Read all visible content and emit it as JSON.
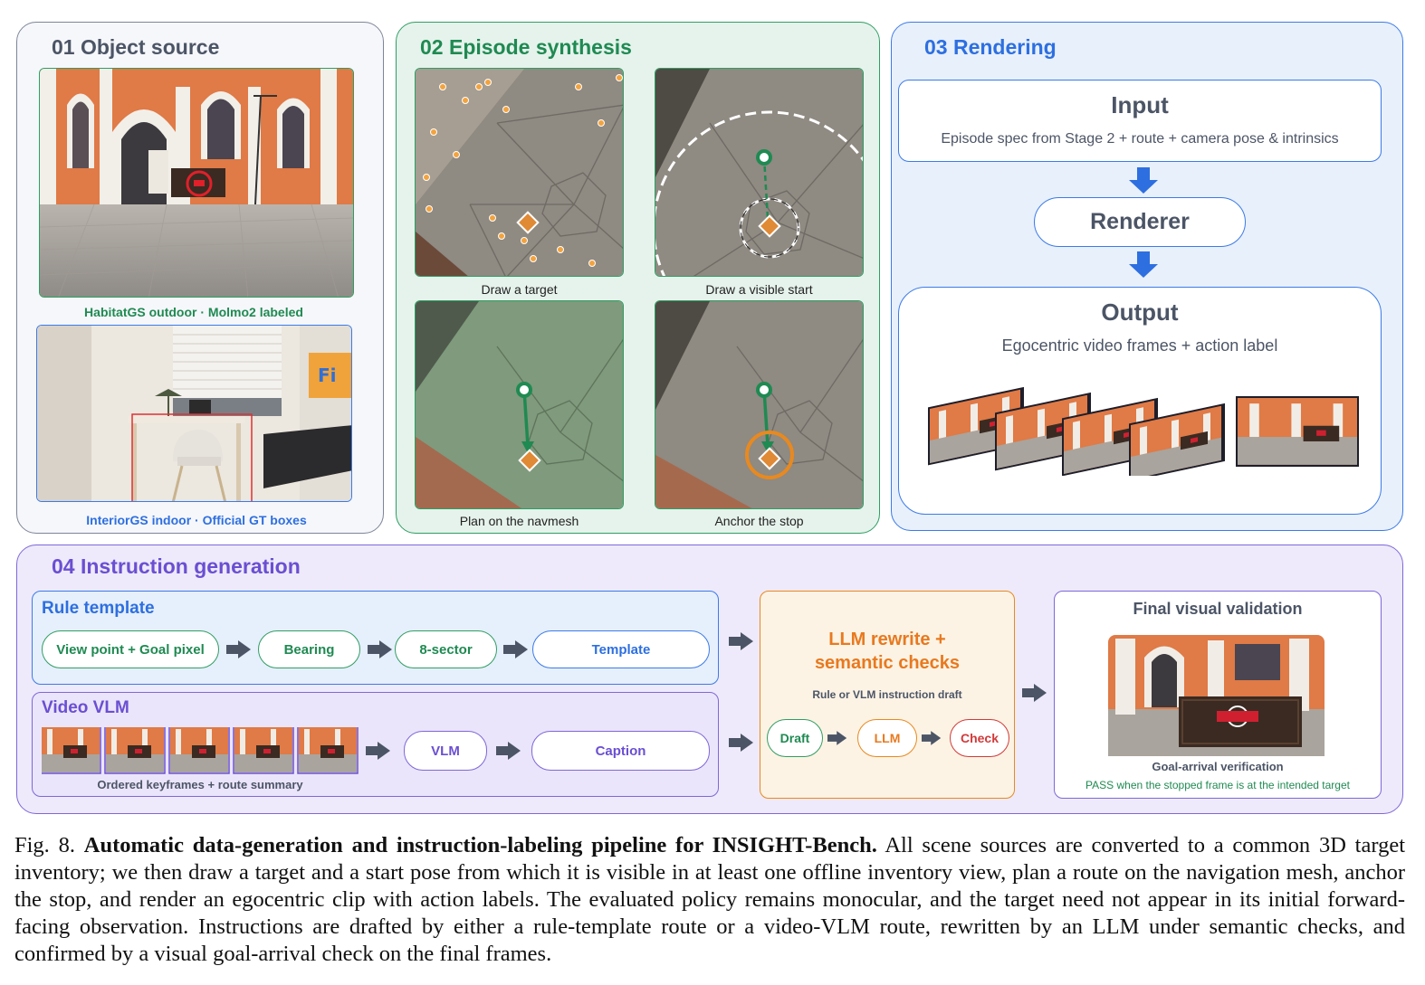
{
  "panel1": {
    "title": "01 Object source",
    "caption_outdoor": "HabitatGS outdoor · Molmo2 labeled",
    "caption_indoor": "InteriorGS indoor · Official GT boxes"
  },
  "panel2": {
    "title": "02 Episode synthesis",
    "steps": [
      "Draw a target",
      "Draw a visible start",
      "Plan on the navmesh",
      "Anchor the stop"
    ]
  },
  "panel3": {
    "title": "03 Rendering",
    "input_title": "Input",
    "input_sub": "Episode spec from Stage 2 + route + camera pose & intrinsics",
    "renderer": "Renderer",
    "output_title": "Output",
    "output_sub": "Egocentric video frames + action label"
  },
  "panel4": {
    "title": "04 Instruction generation",
    "rule": {
      "title": "Rule template",
      "steps": [
        "View point + Goal pixel",
        "Bearing",
        "8-sector",
        "Template"
      ]
    },
    "vlm": {
      "title": "Video VLM",
      "steps": [
        "VLM",
        "Caption"
      ],
      "keyframes_caption": "Ordered keyframes + route summary"
    },
    "llm": {
      "title_line1": "LLM rewrite +",
      "title_line2": "semantic checks",
      "sub": "Rule or VLM instruction draft",
      "steps": [
        "Draft",
        "LLM",
        "Check"
      ]
    },
    "final": {
      "title": "Final visual validation",
      "verify": "Goal-arrival verification",
      "pass": "PASS when the stopped frame is at the intended target"
    }
  },
  "caption": {
    "label": "Fig. 8.",
    "bold": "Automatic data-generation and instruction-labeling pipeline for INSIGHT-Bench.",
    "body": "All scene sources are converted to a common 3D target inventory; we then draw a target and a start pose from which it is visible in at least one offline inventory view, plan a route on the navigation mesh, anchor the stop, and render an egocentric clip with action labels. The evaluated policy remains monocular, and the target need not appear in its initial forward-facing observation. Instructions are drafted by either a rule-template route or a video-VLM route, rewritten by an LLM under semantic checks, and confirmed by a visual goal-arrival check on the final frames."
  },
  "colors": {
    "green": "#1f8a52",
    "blue": "#2d6fe0",
    "purple": "#6a4fd2",
    "orange": "#e8791f",
    "red": "#d23a3a",
    "gray": "#4c5566"
  }
}
